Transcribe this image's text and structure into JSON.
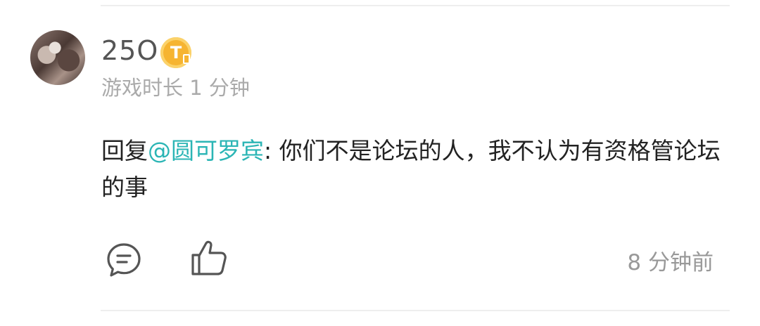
{
  "post": {
    "username": "25O",
    "badge_letter": "T",
    "playtime": "游戏时长 1 分钟",
    "reply_prefix": "回复",
    "mention": "@圆可罗宾",
    "content": ": 你们不是论坛的人，我不认为有资格管论坛的事",
    "time_ago": "8 分钟前"
  },
  "colors": {
    "mention": "#2bb5b5",
    "badge": "#f6b431",
    "muted_text": "#aaaaaa"
  },
  "icons": {
    "reply": "comment-bubble-icon",
    "like": "thumbs-up-icon"
  }
}
